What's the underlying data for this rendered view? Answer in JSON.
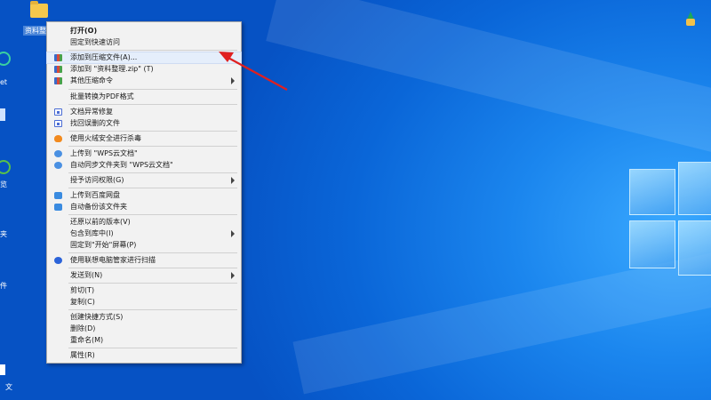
{
  "desktop": {
    "folder_label": "资料整理",
    "left_labels": [
      "et",
      "览",
      "夹",
      "件",
      "文"
    ]
  },
  "menu": {
    "items": [
      {
        "label": "打开(O)",
        "icon": "",
        "bold": true
      },
      {
        "label": "固定到快速访问",
        "icon": ""
      },
      {
        "label": "添加到压缩文件(A)...",
        "icon": "zip-icon",
        "highlight": true
      },
      {
        "label": "添加到 \"资料整理.zip\" (T)",
        "icon": "zip-icon"
      },
      {
        "label": "其他压缩命令",
        "icon": "zip-icon",
        "submenu": true
      },
      {
        "label": "批量转换为PDF格式",
        "icon": ""
      },
      {
        "label": "文档异常修复",
        "icon": "doc-icon"
      },
      {
        "label": "找回误删的文件",
        "icon": "doc-icon"
      },
      {
        "label": "使用火绒安全进行杀毒",
        "icon": "fire-icon"
      },
      {
        "label": "上传到 \"WPS云文档\"",
        "icon": "cloud-icon"
      },
      {
        "label": "自动同步文件夹到 \"WPS云文档\"",
        "icon": "cloud-icon"
      },
      {
        "label": "授予访问权限(G)",
        "icon": "",
        "submenu": true
      },
      {
        "label": "上传到百度网盘",
        "icon": "baidu-icon"
      },
      {
        "label": "自动备份该文件夹",
        "icon": "baidu-icon"
      },
      {
        "label": "还原以前的版本(V)",
        "icon": ""
      },
      {
        "label": "包含到库中(I)",
        "icon": "",
        "submenu": true
      },
      {
        "label": "固定到\"开始\"屏幕(P)",
        "icon": ""
      },
      {
        "label": "使用联想电脑管家进行扫描",
        "icon": "lenovo-icon"
      },
      {
        "label": "发送到(N)",
        "icon": "",
        "submenu": true
      },
      {
        "label": "剪切(T)",
        "icon": ""
      },
      {
        "label": "复制(C)",
        "icon": ""
      },
      {
        "label": "创建快捷方式(S)",
        "icon": ""
      },
      {
        "label": "删除(D)",
        "icon": ""
      },
      {
        "label": "重命名(M)",
        "icon": ""
      },
      {
        "label": "属性(R)",
        "icon": ""
      }
    ]
  },
  "colors": {
    "desktop_bg": "#0a63d6",
    "menu_bg": "#f2f2f2",
    "highlight": "#e5eefb",
    "annotation_arrow": "#e02020"
  }
}
